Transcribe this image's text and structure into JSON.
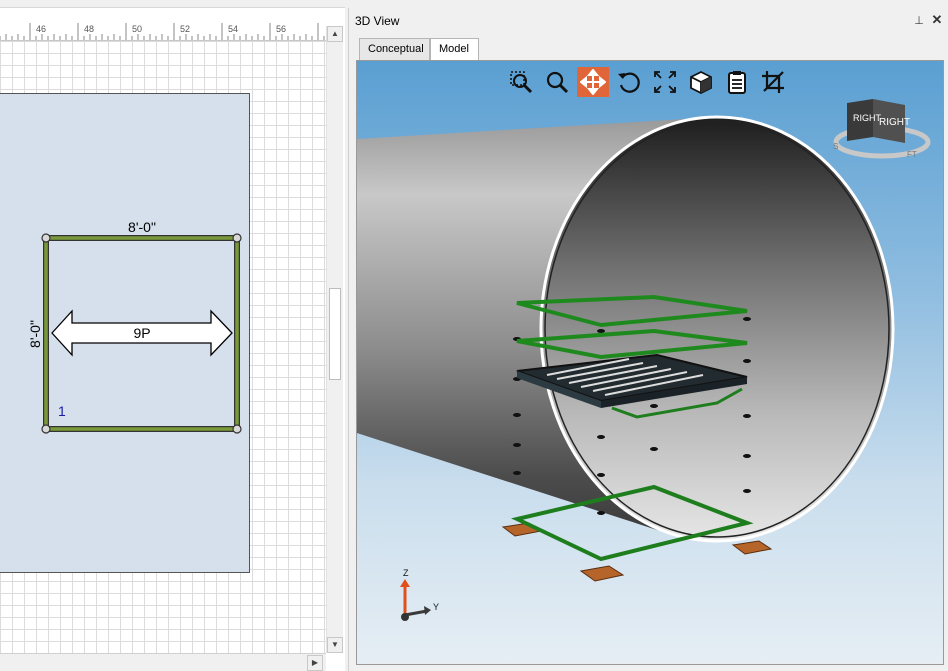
{
  "plan": {
    "ruler_ticks": [
      "46",
      "48",
      "50",
      "52",
      "54",
      "56"
    ],
    "dim_top": "8'-0\"",
    "dim_left": "8'-0\"",
    "arrow_label": "9P",
    "bay_number": "1"
  },
  "view3d": {
    "title": "3D View",
    "pin_icon": "pin-icon",
    "close_icon": "close-icon",
    "tabs": [
      {
        "label": "Conceptual",
        "active": false
      },
      {
        "label": "Model",
        "active": true
      }
    ],
    "toolbar": [
      {
        "icon": "zoom-window-icon",
        "active": false
      },
      {
        "icon": "zoom-icon",
        "active": false
      },
      {
        "icon": "pan-icon",
        "active": true
      },
      {
        "icon": "orbit-icon",
        "active": false
      },
      {
        "icon": "zoom-extents-icon",
        "active": false
      },
      {
        "icon": "view-cube-icon",
        "active": false
      },
      {
        "icon": "clipboard-icon",
        "active": false
      },
      {
        "icon": "crop-section-icon",
        "active": false
      }
    ],
    "navcube": {
      "face_front": "RIGHT",
      "face_side": "RIGHT",
      "ring_left": "S",
      "ring_right": "FT"
    },
    "axes": {
      "z": "Z",
      "y": "Y"
    }
  }
}
